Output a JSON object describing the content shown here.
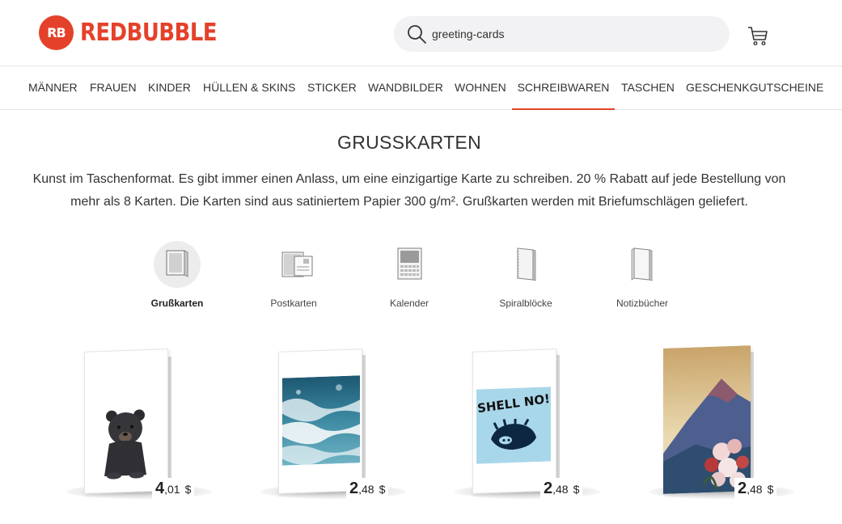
{
  "header": {
    "logo_text": "REDBUBBLE",
    "logo_mark": "RB",
    "search_value": "greeting-cards",
    "brand_color": "#e4412b"
  },
  "nav": {
    "items": [
      "MÄNNER",
      "FRAUEN",
      "KINDER",
      "HÜLLEN & SKINS",
      "STICKER",
      "WANDBILDER",
      "WOHNEN",
      "SCHREIBWAREN",
      "TASCHEN",
      "GESCHENKGUTSCHEINE"
    ],
    "active": "SCHREIBWAREN"
  },
  "page": {
    "title": "GRUSSKARTEN",
    "description": "Kunst im Taschenformat. Es gibt immer einen Anlass, um eine einzigartige Karte zu schreiben. 20 % Rabatt auf jede Bestellung von mehr als 8 Karten. Die Karten sind aus satiniertem Papier 300 g/m². Grußkarten werden mit Briefumschlägen geliefert."
  },
  "categories": [
    {
      "label": "Grußkarten",
      "icon": "greeting-card-icon",
      "selected": true
    },
    {
      "label": "Postkarten",
      "icon": "postcard-icon",
      "selected": false
    },
    {
      "label": "Kalender",
      "icon": "calendar-icon",
      "selected": false
    },
    {
      "label": "Spiralblöcke",
      "icon": "spiral-notebook-icon",
      "selected": false
    },
    {
      "label": "Notizbücher",
      "icon": "notebook-icon",
      "selected": false
    }
  ],
  "products": [
    {
      "price_major": "4",
      "price_minor": ",01",
      "currency": "$",
      "art": "bear-cub"
    },
    {
      "price_major": "2",
      "price_minor": ",48",
      "currency": "$",
      "art": "ocean-waves"
    },
    {
      "price_major": "2",
      "price_minor": ",48",
      "currency": "$",
      "art": "shell-no",
      "art_text": "SHELL NO!"
    },
    {
      "price_major": "2",
      "price_minor": ",48",
      "currency": "$",
      "art": "mountain-flowers"
    }
  ]
}
